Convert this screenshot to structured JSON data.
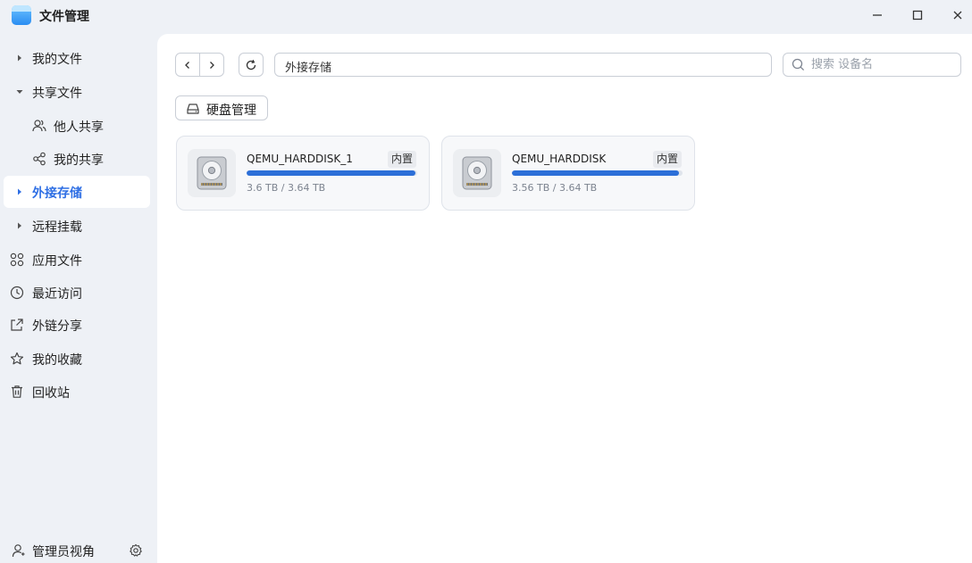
{
  "app": {
    "title": "文件管理"
  },
  "window_controls": {
    "minimize_icon": "minimize-icon",
    "maximize_icon": "maximize-icon",
    "close_icon": "close-icon"
  },
  "sidebar": {
    "items": [
      {
        "label": "我的文件",
        "icon": "caret-right-icon"
      },
      {
        "label": "共享文件",
        "icon": "caret-down-icon"
      },
      {
        "label": "他人共享",
        "icon": "users-icon"
      },
      {
        "label": "我的共享",
        "icon": "share-icon"
      },
      {
        "label": "外接存储",
        "icon": "caret-right-icon",
        "active": true
      },
      {
        "label": "远程挂载",
        "icon": "caret-right-icon"
      },
      {
        "label": "应用文件",
        "icon": "apps-icon"
      },
      {
        "label": "最近访问",
        "icon": "clock-icon"
      },
      {
        "label": "外链分享",
        "icon": "external-link-icon"
      },
      {
        "label": "我的收藏",
        "icon": "star-icon"
      },
      {
        "label": "回收站",
        "icon": "trash-icon"
      }
    ],
    "footer": {
      "label": "管理员视角",
      "icon": "user-icon",
      "settings_icon": "gear-icon"
    }
  },
  "toolbar": {
    "path": "外接存储",
    "search_placeholder": "搜索 设备名"
  },
  "disk_management": {
    "label": "硬盘管理"
  },
  "disks": [
    {
      "name": "QEMU_HARDDISK_1",
      "badge": "内置",
      "usage_text": "3.6 TB / 3.64 TB",
      "used_fraction": 0.989
    },
    {
      "name": "QEMU_HARDDISK",
      "badge": "内置",
      "usage_text": "3.56 TB / 3.64 TB",
      "used_fraction": 0.978
    }
  ],
  "colors": {
    "accent": "#2f6fe4",
    "bar_fill": "#2c6fd8",
    "sidebar_bg": "#eef1f6"
  }
}
